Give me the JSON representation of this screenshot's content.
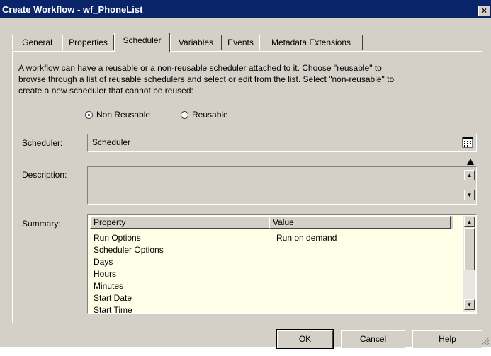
{
  "window": {
    "title": "Create Workflow - wf_PhoneList",
    "close_glyph": "×"
  },
  "tabs": [
    {
      "label": "General"
    },
    {
      "label": "Properties"
    },
    {
      "label": "Scheduler",
      "active": true
    },
    {
      "label": "Variables"
    },
    {
      "label": "Events"
    },
    {
      "label": "Metadata Extensions"
    }
  ],
  "intro": {
    "line1": "A workflow can have a reusable or a non-reusable scheduler attached to it.  Choose \"reusable\" to",
    "line2": "browse through a list of reusable schedulers and select or edit from the list.  Select \"non-reusable\" to",
    "line3": "create a new scheduler that cannot be reused:"
  },
  "radios": {
    "non_reusable": {
      "label": "Non Reusable",
      "checked": true
    },
    "reusable": {
      "label": "Reusable",
      "checked": false
    }
  },
  "scheduler": {
    "label": "Scheduler:",
    "value": "Scheduler",
    "button_icon": "calendar-icon"
  },
  "description": {
    "label": "Description:",
    "value": ""
  },
  "summary": {
    "label": "Summary:",
    "columns": [
      "Property",
      "Value"
    ],
    "rows": [
      {
        "property": "Run Options",
        "value": "Run on demand"
      },
      {
        "property": "Scheduler Options",
        "value": ""
      },
      {
        "property": "Days",
        "value": ""
      },
      {
        "property": "Hours",
        "value": ""
      },
      {
        "property": "Minutes",
        "value": ""
      },
      {
        "property": "Start Date",
        "value": ""
      },
      {
        "property": "Start Time",
        "value": ""
      }
    ]
  },
  "buttons": {
    "ok": "OK",
    "cancel": "Cancel",
    "help": "Help"
  },
  "colors": {
    "title_bar": "#0a246a",
    "dialog_face": "#d4d0c8",
    "grid_background": "#ffffe8"
  }
}
